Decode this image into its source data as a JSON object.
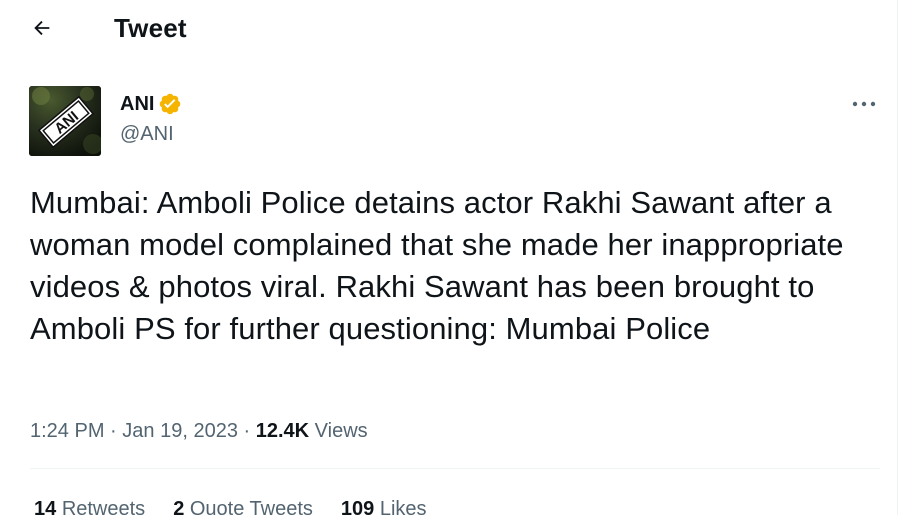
{
  "header": {
    "title": "Tweet"
  },
  "author": {
    "name": "ANI",
    "handle": "@ANI",
    "avatar_text": "ANI",
    "verified_color": "#f4b400"
  },
  "tweet": {
    "text": "Mumbai: Amboli Police detains actor Rakhi Sawant after a woman model complained that she made her inappropriate videos & photos viral. Rakhi Sawant has been brought to Amboli PS for further questioning: Mumbai Police",
    "time": "1:24 PM",
    "date": "Jan 19, 2023",
    "separator": "·",
    "views_count": "12.4K",
    "views_label": "Views"
  },
  "stats": {
    "retweets_count": "14",
    "retweets_label": "Retweets",
    "quotes_count": "2",
    "quotes_label": "Quote Tweets",
    "likes_count": "109",
    "likes_label": "Likes"
  },
  "colors": {
    "text": "#0f1419",
    "secondary": "#536471",
    "divider": "#eff3f4"
  },
  "icons": {
    "back": "back-arrow-icon",
    "verified": "verified-badge-icon",
    "more": "more-options-icon"
  }
}
